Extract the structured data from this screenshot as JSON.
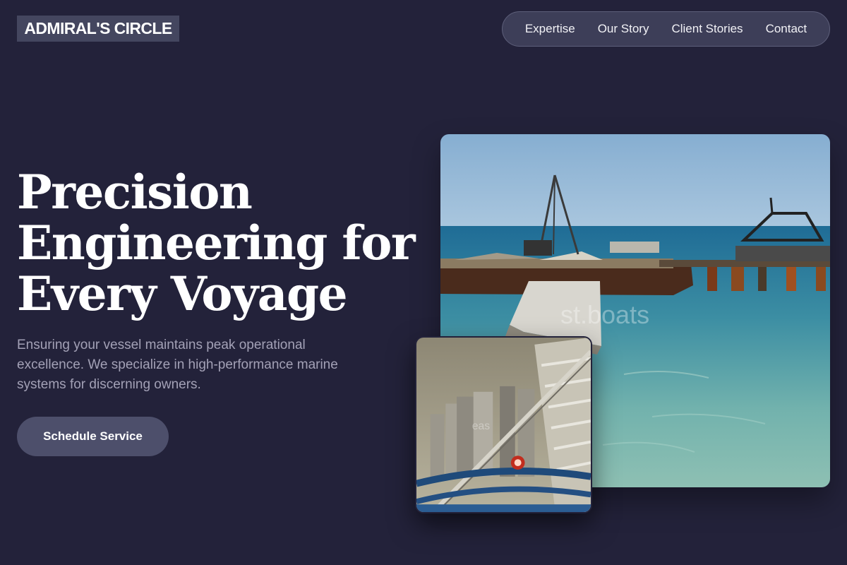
{
  "header": {
    "logo": "ADMIRAL'S CIRCLE",
    "nav": [
      {
        "label": "Expertise"
      },
      {
        "label": "Our Story"
      },
      {
        "label": "Client Stories"
      },
      {
        "label": "Contact"
      }
    ]
  },
  "hero": {
    "title_lines": [
      "Precision",
      "Engineering for",
      "Every Voyage"
    ],
    "subtitle": "Ensuring your vessel maintains peak operational excellence. We specialize in high-performance marine systems for discerning owners.",
    "cta_label": "Schedule Service"
  },
  "images": {
    "main_photo": {
      "watermark": "st.boats"
    },
    "small_photo": {
      "watermark": "eas"
    }
  },
  "colors": {
    "background": "#23223a",
    "nav_pill": "#3d3e58",
    "button": "#4d4f6b",
    "subtitle_text": "#a3a1b6"
  }
}
